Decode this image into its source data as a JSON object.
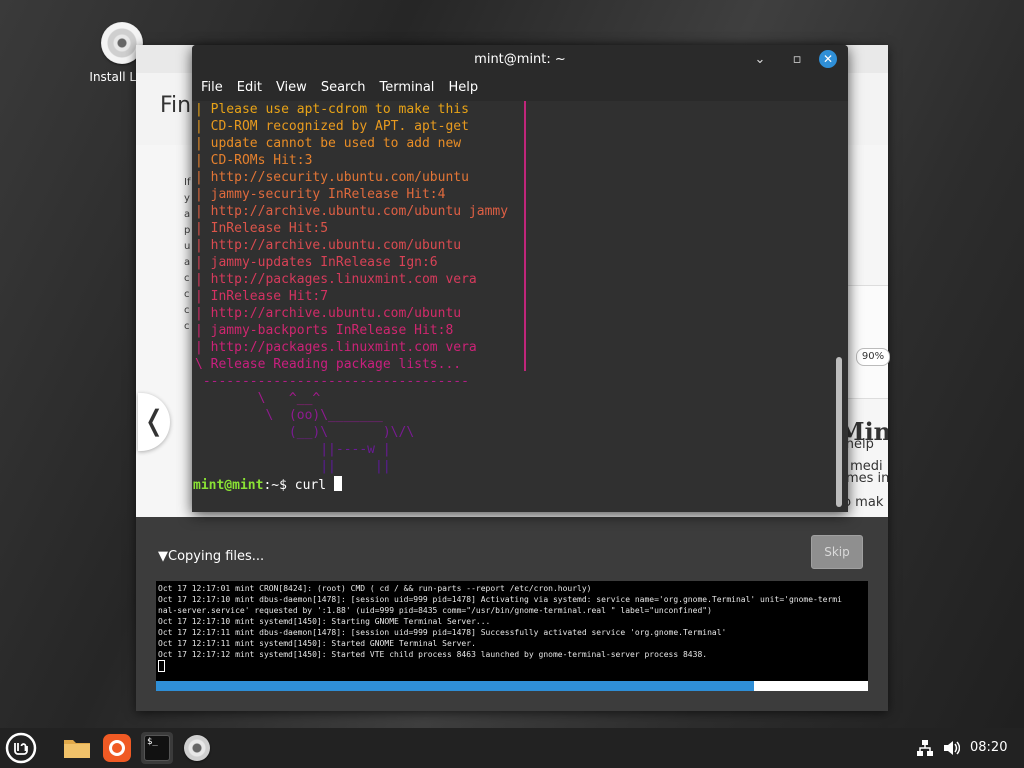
{
  "desktop": {
    "install_icon_label": "Install Linu"
  },
  "installer": {
    "title": "Fin",
    "nav_prev": "❬",
    "zoom": "90%",
    "slide_heading": "Mint",
    "slide_lines": [
      "omes in",
      "to mak",
      "l help ",
      "e medi"
    ],
    "left_column_chars": [
      "If",
      "y",
      "a",
      "p",
      "u",
      "a",
      "c",
      "c",
      "c",
      "c"
    ],
    "copying_label": "Copying files...",
    "skip_label": "Skip",
    "progress_percent": 84,
    "log_lines": [
      "Oct 17 12:17:01 mint CRON[8424]: (root) CMD (   cd / && run-parts --report /etc/cron.hourly)",
      "Oct 17 12:17:10 mint dbus-daemon[1478]: [session uid=999 pid=1478] Activating via systemd: service name='org.gnome.Terminal' unit='gnome-termi",
      "nal-server.service' requested by ':1.88' (uid=999 pid=8435 comm=\"/usr/bin/gnome-terminal.real \" label=\"unconfined\")",
      "Oct 17 12:17:10 mint systemd[1450]: Starting GNOME Terminal Server...",
      "Oct 17 12:17:11 mint dbus-daemon[1478]: [session uid=999 pid=1478] Successfully activated service 'org.gnome.Terminal'",
      "Oct 17 12:17:11 mint systemd[1450]: Started GNOME Terminal Server.",
      "Oct 17 12:17:12 mint systemd[1450]: Started VTE child process 8463 launched by gnome-terminal-server process 8438."
    ]
  },
  "terminal": {
    "title": "mint@mint: ~",
    "menu": [
      "File",
      "Edit",
      "View",
      "Search",
      "Terminal",
      "Help"
    ],
    "output_lines": [
      {
        "text": "| Please use apt-cdrom to make this",
        "color": "#e8a317"
      },
      {
        "text": "| CD-ROM recognized by APT. apt-get",
        "color": "#e89a1f"
      },
      {
        "text": "| update cannot be used to add new",
        "color": "#e88d26"
      },
      {
        "text": "| CD-ROMs Hit:3",
        "color": "#e5802e"
      },
      {
        "text": "| http://security.ubuntu.com/ubuntu",
        "color": "#e27536"
      },
      {
        "text": "| jammy-security InRelease Hit:4",
        "color": "#e06a3d"
      },
      {
        "text": "| http://archive.ubuntu.com/ubuntu jammy",
        "color": "#de5f44"
      },
      {
        "text": "| InRelease Hit:5",
        "color": "#dc554a"
      },
      {
        "text": "| http://archive.ubuntu.com/ubuntu",
        "color": "#da4b50"
      },
      {
        "text": "| jammy-updates InRelease Ign:6",
        "color": "#d84256"
      },
      {
        "text": "| http://packages.linuxmint.com vera",
        "color": "#d63a5c"
      },
      {
        "text": "| InRelease Hit:7",
        "color": "#d43262"
      },
      {
        "text": "| http://archive.ubuntu.com/ubuntu",
        "color": "#d22b68"
      },
      {
        "text": "| jammy-backports InRelease Hit:8",
        "color": "#cf266f"
      },
      {
        "text": "| http://packages.linuxmint.com vera",
        "color": "#cc2277"
      },
      {
        "text": "\\ Release Reading package lists...",
        "color": "#c91f7f"
      },
      {
        "text": " ----------------------------------",
        "color": "#b21d86"
      },
      {
        "text": "        \\   ^__^",
        "color": "#a31a8c"
      },
      {
        "text": "         \\  (oo)\\_______",
        "color": "#8f1a90"
      },
      {
        "text": "            (__)\\       )\\/\\",
        "color": "#7a1a94"
      },
      {
        "text": "                ||----w |",
        "color": "#6a1a96"
      },
      {
        "text": "                ||     ||",
        "color": "#5c1a98"
      }
    ],
    "prompt_user": "mint@mint",
    "prompt_path": ":~$ ",
    "prompt_command": "curl "
  },
  "taskbar": {
    "clock": "08:20",
    "terminal_icon_text": "$_"
  },
  "colors": {
    "accent": "#2f8fd7",
    "prompt_green": "#8ae234"
  }
}
